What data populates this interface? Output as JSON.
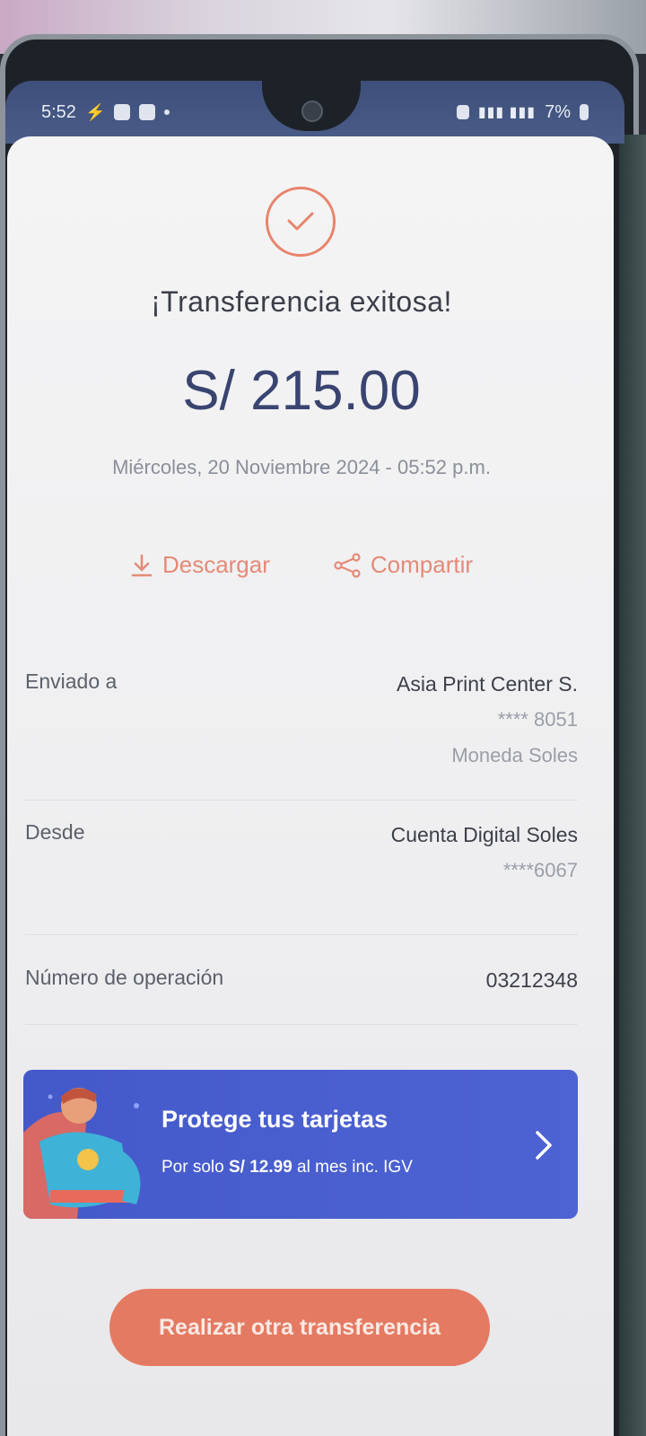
{
  "status_bar": {
    "time": "5:52",
    "battery": "7%"
  },
  "receipt": {
    "title": "¡Transferencia exitosa!",
    "amount": "S/ 215.00",
    "datetime": "Miércoles, 20 Noviembre 2024 - 05:52 p.m.",
    "download_label": "Descargar",
    "share_label": "Compartir"
  },
  "details": {
    "sent_to": {
      "label": "Enviado a",
      "name": "Asia Print Center S.",
      "account": "**** 8051",
      "currency": "Moneda Soles"
    },
    "from": {
      "label": "Desde",
      "account_name": "Cuenta Digital Soles",
      "account": "****6067"
    },
    "operation": {
      "label": "Número de operación",
      "number": "03212348"
    }
  },
  "promo": {
    "title": "Protege tus tarjetas",
    "sub_prefix": "Por solo ",
    "sub_price": "S/ 12.99",
    "sub_suffix": " al mes inc. IGV"
  },
  "cta": {
    "label": "Realizar otra transferencia"
  },
  "colors": {
    "accent": "#e47a62",
    "amount": "#3a4470",
    "promo_bg": "#4a5fd0"
  }
}
